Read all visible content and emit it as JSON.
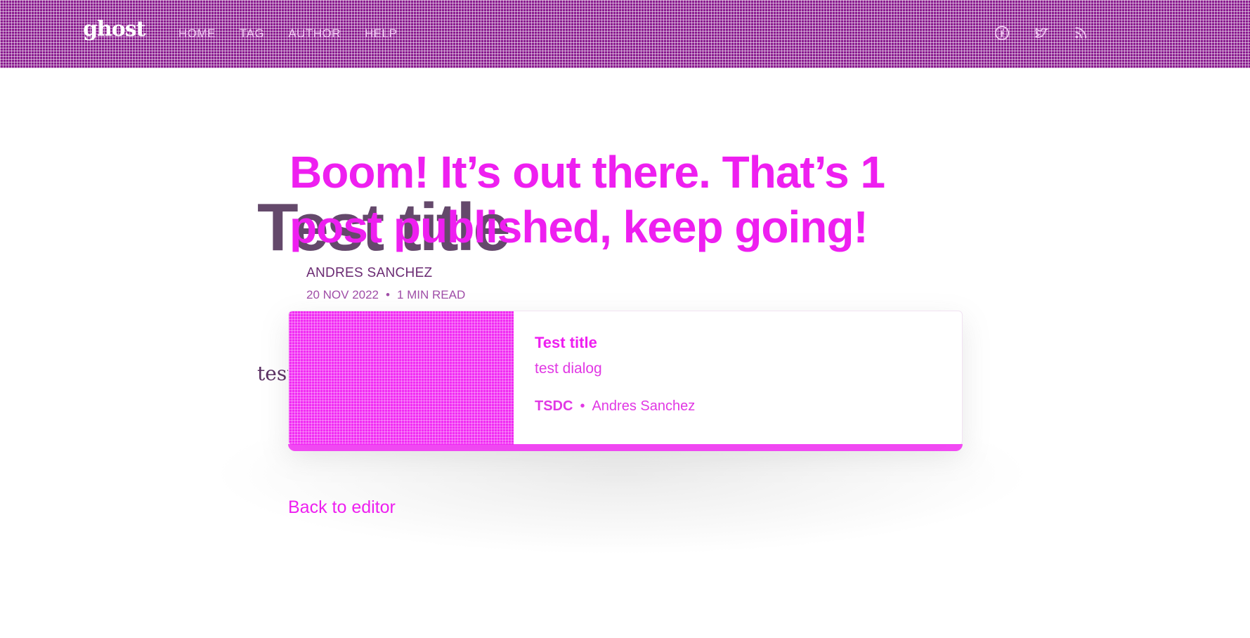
{
  "header": {
    "logo": "ghost",
    "nav": [
      "HOME",
      "TAG",
      "AUTHOR",
      "HELP"
    ],
    "social_icons": [
      "facebook-icon",
      "twitter-icon",
      "rss-icon"
    ],
    "background_color": "#8a1c8f"
  },
  "article": {
    "title": "Test title",
    "excerpt": "test dialog",
    "author": "ANDRES SANCHEZ",
    "date": "20 NOV 2022",
    "read_time": "1 MIN READ"
  },
  "publish_banner": {
    "heading": "Boom! It’s out there. That’s 1 post published, keep going!",
    "accent_color": "#ee1ff0"
  },
  "bookmark_card": {
    "title": "Test title",
    "description": "test dialog",
    "publisher": "TSDC",
    "author": "Andres Sanchez"
  },
  "actions": {
    "back_to_editor": "Back to editor"
  }
}
